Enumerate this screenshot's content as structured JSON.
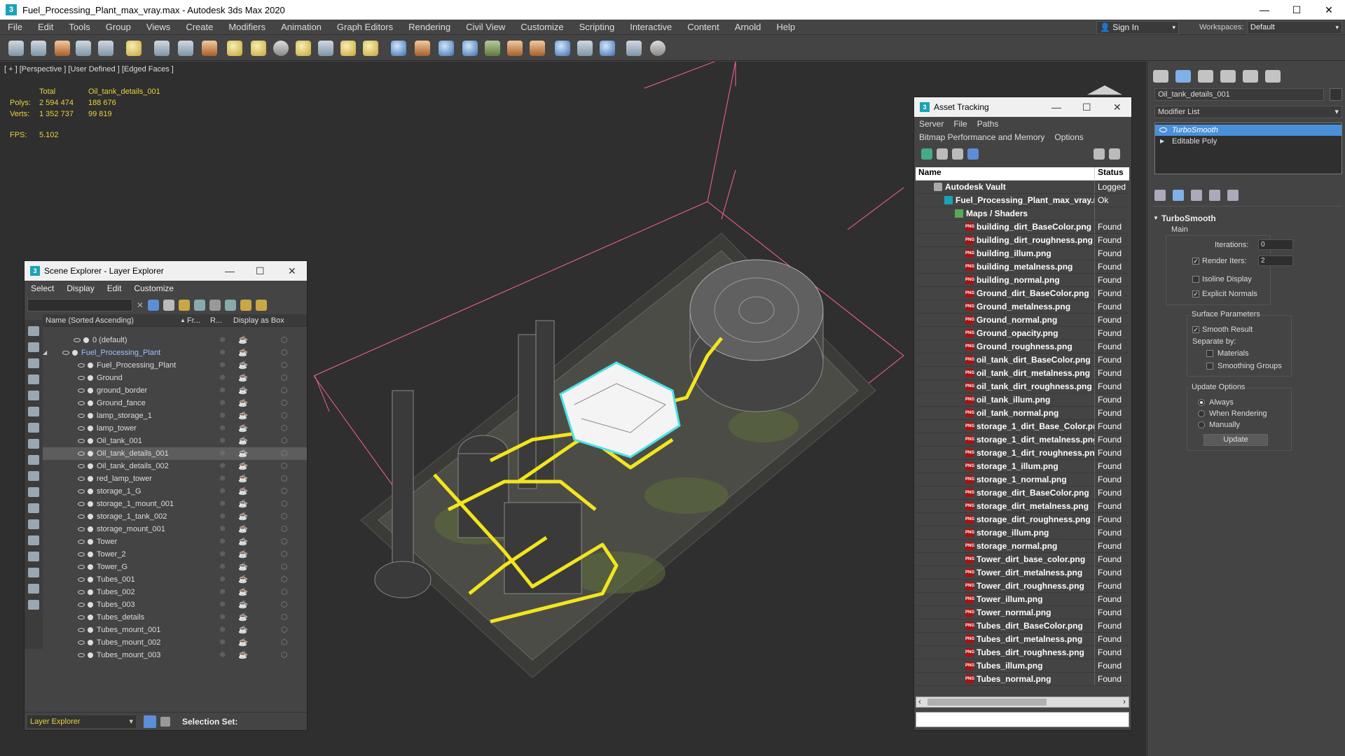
{
  "window": {
    "title": "Fuel_Processing_Plant_max_vray.max - Autodesk 3ds Max 2020",
    "minimize": "—",
    "maximize": "☐",
    "close": "✕"
  },
  "menu": [
    "File",
    "Edit",
    "Tools",
    "Group",
    "Views",
    "Create",
    "Modifiers",
    "Animation",
    "Graph Editors",
    "Rendering",
    "Civil View",
    "Customize",
    "Scripting",
    "Interactive",
    "Content",
    "Arnold",
    "Help"
  ],
  "signin": {
    "label": "Sign In",
    "arrow": "▾"
  },
  "workspaces": {
    "label": "Workspaces:",
    "value": "Default",
    "arrow": "▾"
  },
  "viewport": {
    "label": "[ + ] [Perspective ] [User Defined ] [Edged Faces ]",
    "stats": {
      "col_total": "Total",
      "col_object": "Oil_tank_details_001",
      "polys_label": "Polys:",
      "polys_total": "2 594 474",
      "polys_object": "188 676",
      "verts_label": "Verts:",
      "verts_total": "1 352 737",
      "verts_object": "99 819",
      "fps_label": "FPS:",
      "fps_value": "5.102"
    }
  },
  "layer_explorer": {
    "title": "Scene Explorer - Layer Explorer",
    "menu": [
      "Select",
      "Display",
      "Edit",
      "Customize"
    ],
    "columns": {
      "name": "Name (Sorted Ascending)",
      "sort": "▲",
      "frozen": "Fr...",
      "render": "R...",
      "box": "Display as Box"
    },
    "clear": "✕",
    "rows": [
      {
        "name": "0 (default)",
        "level": 0
      },
      {
        "name": "Fuel_Processing_Plant",
        "level": 1,
        "expand": "◢"
      },
      {
        "name": "Fuel_Processing_Plant",
        "level": 2
      },
      {
        "name": "Ground",
        "level": 2
      },
      {
        "name": "ground_border",
        "level": 2
      },
      {
        "name": "Ground_fance",
        "level": 2
      },
      {
        "name": "lamp_storage_1",
        "level": 2
      },
      {
        "name": "lamp_tower",
        "level": 2
      },
      {
        "name": "Oil_tank_001",
        "level": 2
      },
      {
        "name": "Oil_tank_details_001",
        "level": 2,
        "selected": true
      },
      {
        "name": "Oil_tank_details_002",
        "level": 2
      },
      {
        "name": "red_lamp_tower",
        "level": 2
      },
      {
        "name": "storage_1_G",
        "level": 2
      },
      {
        "name": "storage_1_mount_001",
        "level": 2
      },
      {
        "name": "storage_1_tank_002",
        "level": 2
      },
      {
        "name": "storage_mount_001",
        "level": 2
      },
      {
        "name": "Tower",
        "level": 2
      },
      {
        "name": "Tower_2",
        "level": 2
      },
      {
        "name": "Tower_G",
        "level": 2
      },
      {
        "name": "Tubes_001",
        "level": 2
      },
      {
        "name": "Tubes_002",
        "level": 2
      },
      {
        "name": "Tubes_003",
        "level": 2
      },
      {
        "name": "Tubes_details",
        "level": 2
      },
      {
        "name": "Tubes_mount_001",
        "level": 2
      },
      {
        "name": "Tubes_mount_002",
        "level": 2
      },
      {
        "name": "Tubes_mount_003",
        "level": 2
      }
    ],
    "footer": {
      "explorer": "Layer Explorer",
      "arrow": "▾",
      "selection_set": "Selection Set:"
    }
  },
  "asset_tracking": {
    "title": "Asset Tracking",
    "menu1": [
      "Server",
      "File",
      "Paths"
    ],
    "menu2": [
      "Bitmap Performance and Memory",
      "Options"
    ],
    "col_name": "Name",
    "col_status": "Status",
    "vault": {
      "name": "Autodesk Vault",
      "status": "Logged"
    },
    "file": {
      "name": "Fuel_Processing_Plant_max_vray.max",
      "status": "Ok"
    },
    "maps": {
      "name": "Maps / Shaders",
      "status": ""
    },
    "png_label": "PNG",
    "assets": [
      {
        "name": "building_dirt_BaseColor.png",
        "status": "Found"
      },
      {
        "name": "building_dirt_roughness.png",
        "status": "Found"
      },
      {
        "name": "building_illum.png",
        "status": "Found"
      },
      {
        "name": "building_metalness.png",
        "status": "Found"
      },
      {
        "name": "building_normal.png",
        "status": "Found"
      },
      {
        "name": "Ground_dirt_BaseColor.png",
        "status": "Found"
      },
      {
        "name": "Ground_metalness.png",
        "status": "Found"
      },
      {
        "name": "Ground_normal.png",
        "status": "Found"
      },
      {
        "name": "Ground_opacity.png",
        "status": "Found"
      },
      {
        "name": "Ground_roughness.png",
        "status": "Found"
      },
      {
        "name": "oil_tank_dirt_BaseColor.png",
        "status": "Found"
      },
      {
        "name": "oil_tank_dirt_metalness.png",
        "status": "Found"
      },
      {
        "name": "oil_tank_dirt_roughness.png",
        "status": "Found"
      },
      {
        "name": "oil_tank_illum.png",
        "status": "Found"
      },
      {
        "name": "oil_tank_normal.png",
        "status": "Found"
      },
      {
        "name": "storage_1_dirt_Base_Color.png",
        "status": "Found"
      },
      {
        "name": "storage_1_dirt_metalness.png",
        "status": "Found"
      },
      {
        "name": "storage_1_dirt_roughness.png",
        "status": "Found"
      },
      {
        "name": "storage_1_illum.png",
        "status": "Found"
      },
      {
        "name": "storage_1_normal.png",
        "status": "Found"
      },
      {
        "name": "storage_dirt_BaseColor.png",
        "status": "Found"
      },
      {
        "name": "storage_dirt_metalness.png",
        "status": "Found"
      },
      {
        "name": "storage_dirt_roughness.png",
        "status": "Found"
      },
      {
        "name": "storage_illum.png",
        "status": "Found"
      },
      {
        "name": "storage_normal.png",
        "status": "Found"
      },
      {
        "name": "Tower_dirt_base_color.png",
        "status": "Found"
      },
      {
        "name": "Tower_dirt_metalness.png",
        "status": "Found"
      },
      {
        "name": "Tower_dirt_roughness.png",
        "status": "Found"
      },
      {
        "name": "Tower_illum.png",
        "status": "Found"
      },
      {
        "name": "Tower_normal.png",
        "status": "Found"
      },
      {
        "name": "Tubes_dirt_BaseColor.png",
        "status": "Found"
      },
      {
        "name": "Tubes_dirt_metalness.png",
        "status": "Found"
      },
      {
        "name": "Tubes_dirt_roughness.png",
        "status": "Found"
      },
      {
        "name": "Tubes_illum.png",
        "status": "Found"
      },
      {
        "name": "Tubes_normal.png",
        "status": "Found"
      }
    ],
    "scroll_left": "‹",
    "scroll_right": "›"
  },
  "command_panel": {
    "object_name": "Oil_tank_details_001",
    "modifier_list": "Modifier List",
    "modlist_arrow": "▾",
    "stack": [
      {
        "name": "TurboSmooth",
        "selected": true
      },
      {
        "name": "Editable Poly",
        "selected": false,
        "arrow": "▶"
      }
    ],
    "rollout_title": "TurboSmooth",
    "rollout_toggle": "▼",
    "main_label": "Main",
    "iterations_label": "Iterations:",
    "iterations_value": "0",
    "render_iters_label": "Render Iters:",
    "render_iters_value": "2",
    "isoline": "Isoline Display",
    "explicit": "Explicit Normals",
    "surface_params": "Surface Parameters",
    "smooth_result": "Smooth Result",
    "separate_by": "Separate by:",
    "materials": "Materials",
    "smoothing_groups": "Smoothing Groups",
    "update_options": "Update Options",
    "always": "Always",
    "when_rendering": "When Rendering",
    "manually": "Manually",
    "update_btn": "Update",
    "check": "✓"
  },
  "colors": {
    "accent": "#e8d23a",
    "selection": "#4a90d9",
    "frame": "#ff5fa0"
  }
}
